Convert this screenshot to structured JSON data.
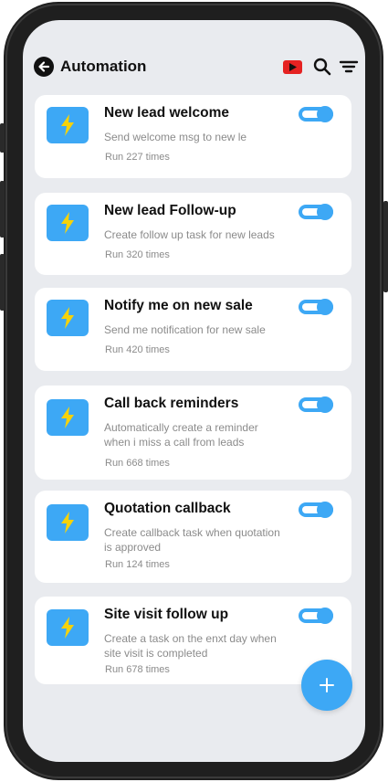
{
  "header": {
    "title": "Automation",
    "icons": [
      "back-arrow-icon",
      "youtube-icon",
      "search-icon",
      "filter-icon"
    ]
  },
  "colors": {
    "accent": "#3da8f5",
    "youtube": "#e52222",
    "screen_bg": "#e9ebef"
  },
  "automations": [
    {
      "title": "New lead welcome",
      "description": "Send welcome msg to new le",
      "runs": "Run 227 times",
      "enabled": true
    },
    {
      "title": "New lead Follow-up",
      "description": "Create follow up task for new leads",
      "runs": "Run 320 times",
      "enabled": true
    },
    {
      "title": "Notify me on new sale",
      "description": "Send me notification for new sale",
      "runs": "Run 420 times",
      "enabled": true
    },
    {
      "title": "Call back reminders",
      "description": "Automatically create a reminder\nwhen i miss a call from leads",
      "runs": "Run 668 times",
      "enabled": true
    },
    {
      "title": "Quotation callback",
      "description": "Create callback task when quotation\nis approved",
      "runs": "Run 124 times",
      "enabled": true
    },
    {
      "title": "Site visit follow up",
      "description": "Create a task on the enxt day when\nsite visit is completed",
      "runs": "Run 678 times",
      "enabled": true
    }
  ],
  "fab": {
    "label": "+"
  }
}
